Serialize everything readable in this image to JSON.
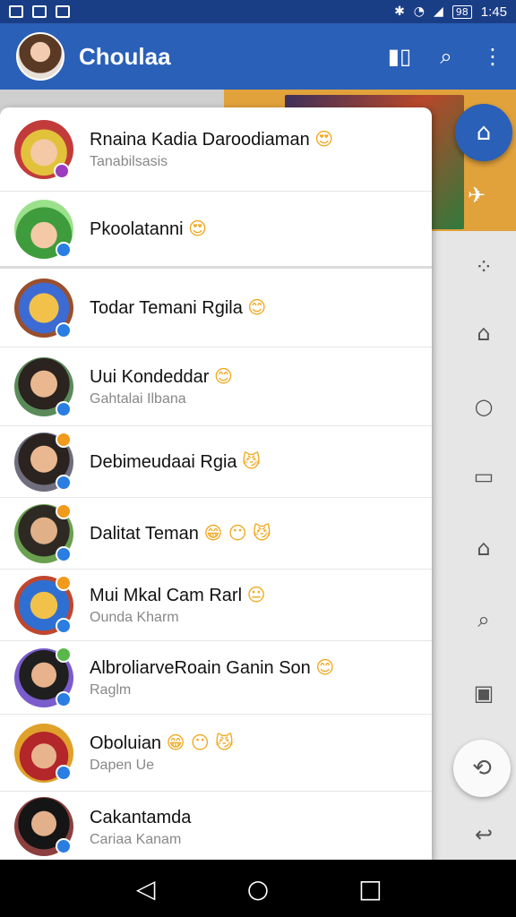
{
  "status_bar": {
    "time": "1:45",
    "battery": "98"
  },
  "app_bar": {
    "title": "Choulaa"
  },
  "contacts": [
    {
      "name": "Rnaina Kadia Daroodiaman",
      "emoji": "😍",
      "sub": "Tanabilsasis"
    },
    {
      "name": "Pkoolatanni",
      "emoji": "😍",
      "sub": ""
    },
    {
      "name": "Todar Temani Rgila",
      "emoji": "😊",
      "sub": ""
    },
    {
      "name": "Uui Kondeddar",
      "emoji": "😊",
      "sub": "Gahtalai Ilbana"
    },
    {
      "name": "Debimeudaai Rgia",
      "emoji": "😼",
      "sub": ""
    },
    {
      "name": "Dalitat Teman",
      "emoji": "😁 😶 😼",
      "sub": ""
    },
    {
      "name": "Mui Mkal Cam Rarl",
      "emoji": "😐",
      "sub": "Ounda Kharm"
    },
    {
      "name": "AlbroliarveRoain Ganin Son",
      "emoji": "😊",
      "sub": "Raglm"
    },
    {
      "name": "Oboluian",
      "emoji": "😁 😶 😼",
      "sub": "Dapen Ue"
    },
    {
      "name": "Cakantamda",
      "emoji": "",
      "sub": "Cariaa Kanam"
    }
  ]
}
